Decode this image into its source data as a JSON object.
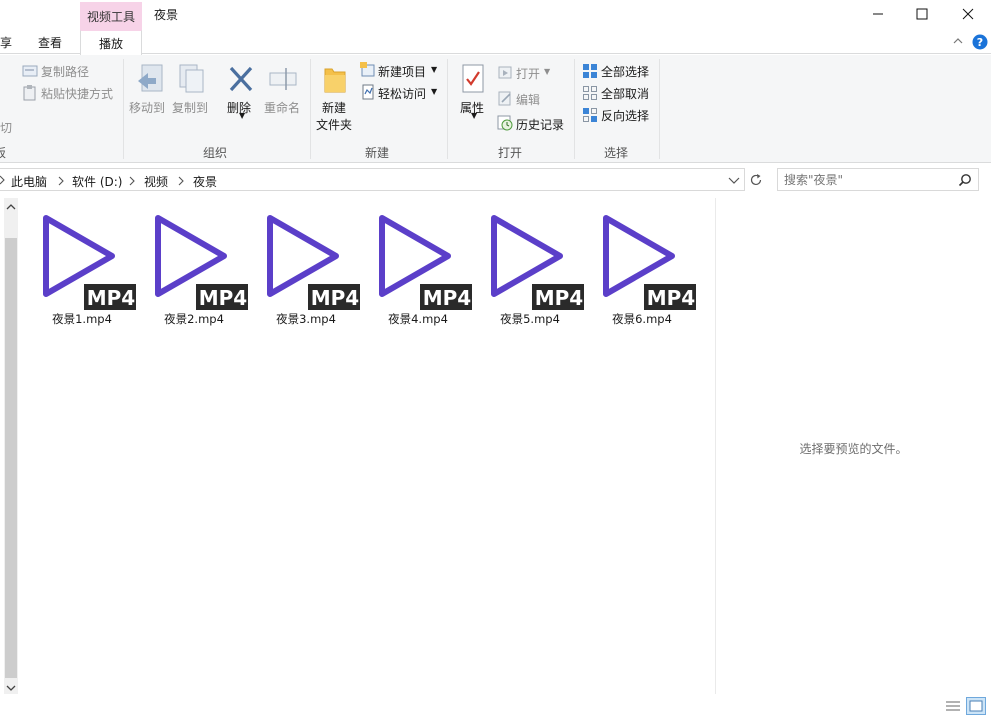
{
  "titlebar": {
    "context_tab": "视频工具",
    "title": "夜景"
  },
  "tabs": {
    "share_partial": "享",
    "view": "查看",
    "play": "播放"
  },
  "ribbon": {
    "clipboard": {
      "copy_path": "复制路径",
      "paste_shortcut": "粘贴快捷方式",
      "cut_partial": "剪切",
      "label_partial": "板"
    },
    "organize": {
      "move_to": "移动到",
      "copy_to": "复制到",
      "delete": "删除",
      "rename": "重命名",
      "label": "组织"
    },
    "new": {
      "new_folder_line1": "新建",
      "new_folder_line2": "文件夹",
      "new_item": "新建项目",
      "easy_access": "轻松访问",
      "label": "新建"
    },
    "open": {
      "properties": "属性",
      "open": "打开",
      "edit": "编辑",
      "history": "历史记录",
      "label": "打开"
    },
    "select": {
      "select_all": "全部选择",
      "select_none": "全部取消",
      "invert": "反向选择",
      "label": "选择"
    }
  },
  "address": {
    "crumbs": [
      "此电脑",
      "软件 (D:)",
      "视频",
      "夜景"
    ]
  },
  "search": {
    "placeholder": "搜索\"夜景\""
  },
  "files": [
    {
      "name": "夜景1.mp4",
      "badge": "MP4"
    },
    {
      "name": "夜景2.mp4",
      "badge": "MP4"
    },
    {
      "name": "夜景3.mp4",
      "badge": "MP4"
    },
    {
      "name": "夜景4.mp4",
      "badge": "MP4"
    },
    {
      "name": "夜景5.mp4",
      "badge": "MP4"
    },
    {
      "name": "夜景6.mp4",
      "badge": "MP4"
    }
  ],
  "preview": {
    "empty_text": "选择要预览的文件。"
  },
  "colors": {
    "context_tab": "#f7d3e8",
    "play_icon": "#5b3fc9",
    "badge_bg": "#2a2a2a",
    "ribbon_bg": "#f5f6f7"
  }
}
